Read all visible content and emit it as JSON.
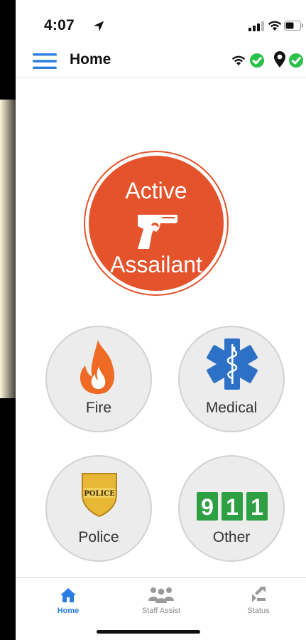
{
  "status_bar": {
    "time": "4:07"
  },
  "app_bar": {
    "title": "Home"
  },
  "emergency": {
    "active_assailant": {
      "line1": "Active",
      "line2": "Assailant"
    },
    "fire": {
      "label": "Fire"
    },
    "medical": {
      "label": "Medical"
    },
    "police": {
      "label": "Police",
      "badge_text": "POLICE"
    },
    "other": {
      "label": "Other",
      "digits": [
        "9",
        "1",
        "1"
      ]
    }
  },
  "tabs": [
    {
      "label": "Home",
      "icon": "home-icon",
      "selected": true
    },
    {
      "label": "Staff Assist",
      "icon": "staff-assist-icon",
      "selected": false
    },
    {
      "label": "Status",
      "icon": "status-icon",
      "selected": false
    }
  ],
  "colors": {
    "accent_blue": "#2a7de1",
    "alert_orange": "#e4532b",
    "ok_green": "#2bc04a",
    "grid_green": "#2ea043",
    "badge_gold": "#e7b735"
  }
}
